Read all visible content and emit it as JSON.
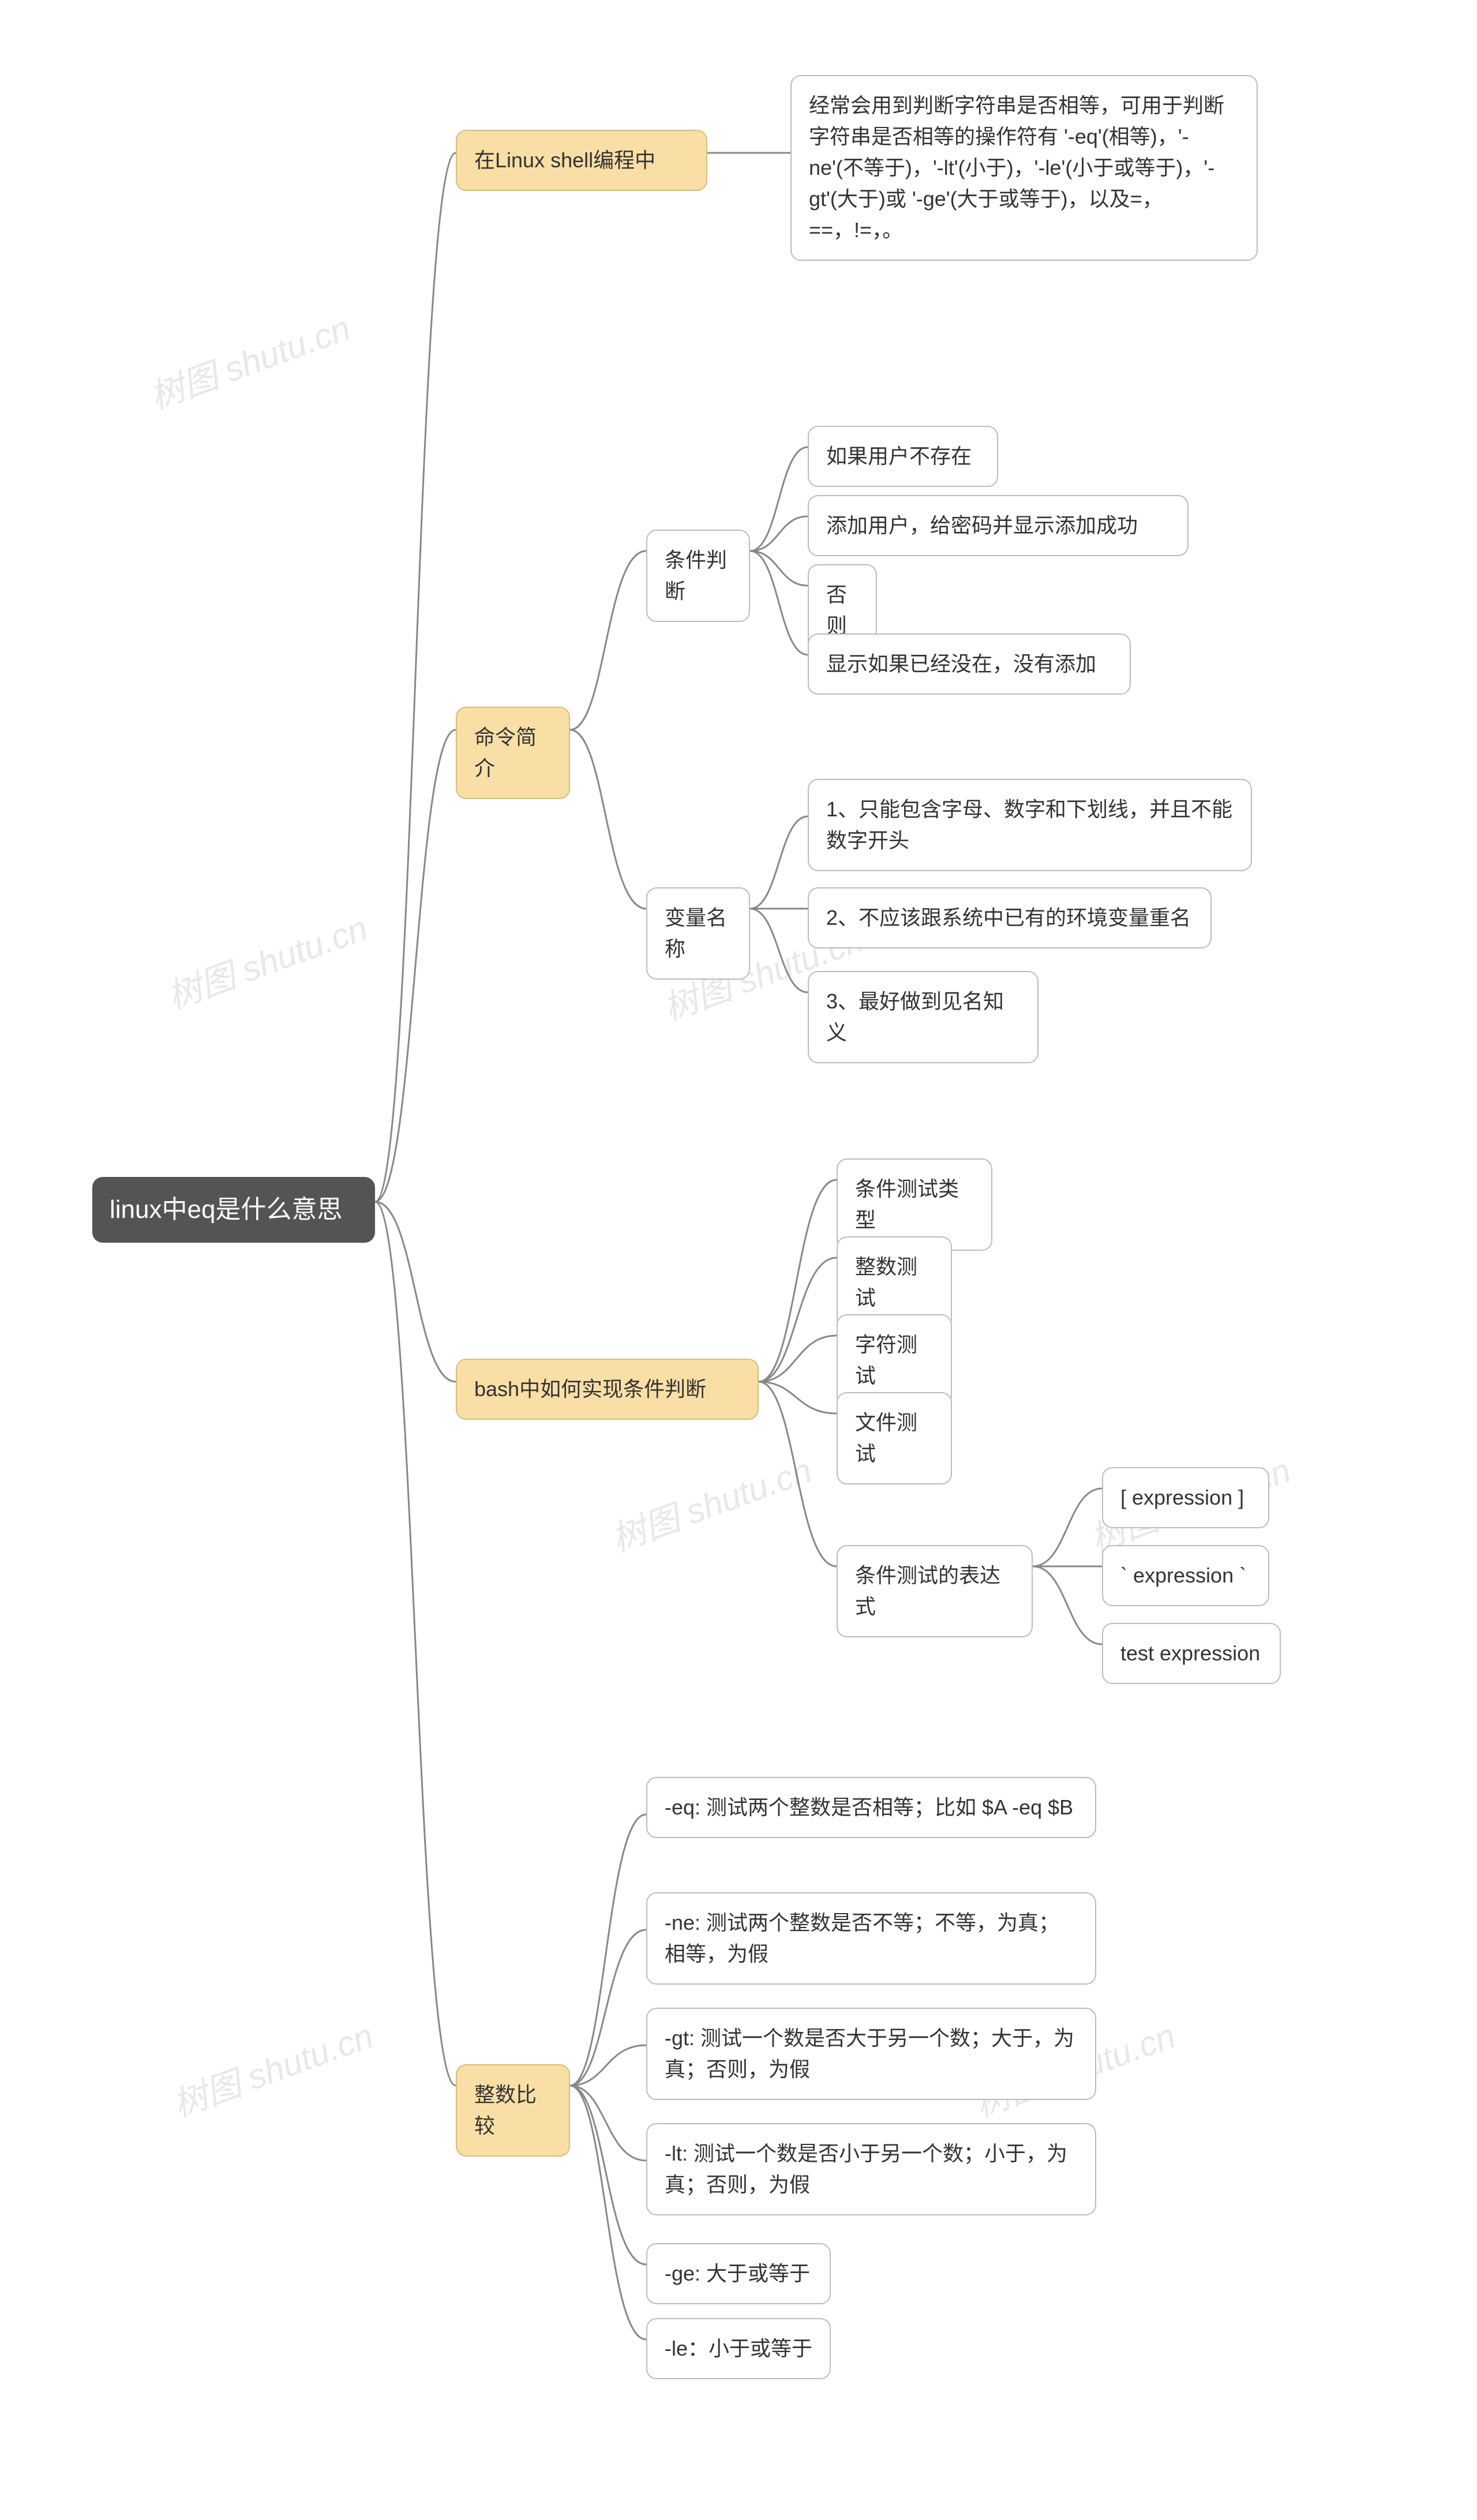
{
  "root": "linux中eq是什么意思",
  "b1": {
    "label": "在Linux shell编程中",
    "c1": "经常会用到判断字符串是否相等，可用于判断字符串是否相等的操作符有 '-eq'(相等)，'-ne'(不等于)，'-lt'(小于)，'-le'(小于或等于)，'-gt'(大于)或 '-ge'(大于或等于)，以及=，==，!=，。"
  },
  "b2": {
    "label": "命令简介",
    "sub1": {
      "label": "条件判断",
      "c1": "如果用户不存在",
      "c2": "添加用户，给密码并显示添加成功",
      "c3": "否则",
      "c4": "显示如果已经没在，没有添加"
    },
    "sub2": {
      "label": "变量名称",
      "c1": "1、只能包含字母、数字和下划线，并且不能数字开头",
      "c2": "2、不应该跟系统中已有的环境变量重名",
      "c3": "3、最好做到见名知义"
    }
  },
  "b3": {
    "label": "bash中如何实现条件判断",
    "c1": "条件测试类型",
    "c2": "整数测试",
    "c3": "字符测试",
    "c4": "文件测试",
    "sub1": {
      "label": "条件测试的表达式",
      "c1": "[ expression ]",
      "c2": "` expression `",
      "c3": "test expression"
    }
  },
  "b4": {
    "label": "整数比较",
    "c1": "-eq: 测试两个整数是否相等；比如 $A -eq $B",
    "c2": "-ne: 测试两个整数是否不等；不等，为真；相等，为假",
    "c3": "-gt: 测试一个数是否大于另一个数；大于，为真；否则，为假",
    "c4": "-lt: 测试一个数是否小于另一个数；小于，为真；否则，为假",
    "c5": "-ge: 大于或等于",
    "c6": "-le：小于或等于"
  },
  "wm": "树图 shutu.cn"
}
